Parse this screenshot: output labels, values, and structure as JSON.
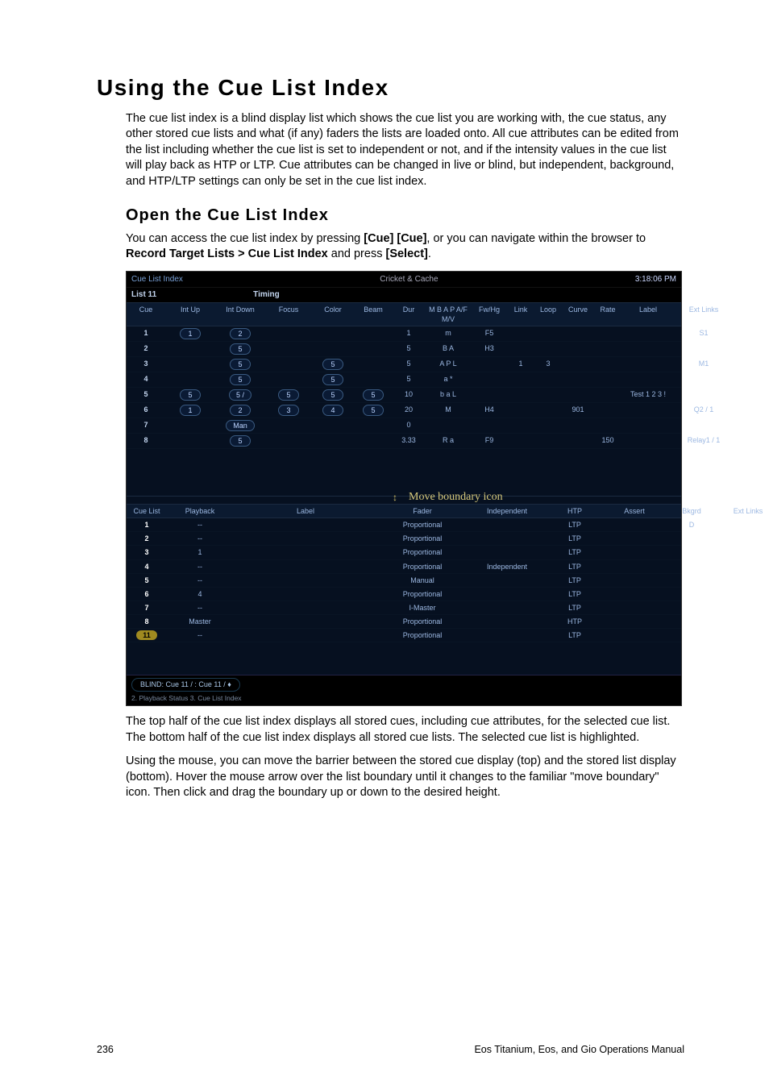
{
  "page": {
    "number": "236",
    "manual_title": "Eos Titanium, Eos, and Gio Operations Manual"
  },
  "heading": "Using the Cue List Index",
  "intro": "The cue list index is a blind display list which shows the cue list you are working with, the cue status, any other stored cue lists and what (if any) faders the lists are loaded onto. All cue attributes can be edited from the list including whether the cue list is set to independent or not, and if the intensity values in the cue list will play back as HTP or LTP. Cue attributes can be changed in live or blind, but independent, background, and HTP/LTP settings can only be set in the cue list index.",
  "subhead": "Open the Cue List Index",
  "open_para_pre": "You can access the cue list index by pressing ",
  "open_bold1": "[Cue] [Cue]",
  "open_mid": ", or you can navigate within the browser to ",
  "open_bold2": "Record Target Lists > Cue List Index",
  "open_mid2": " and press ",
  "open_bold3": "[Select]",
  "open_end": ".",
  "screenshot": {
    "title_left": "Cue List Index",
    "title_center": "Cricket & Cache",
    "title_right": "3:18:06 PM",
    "list_label": "List 11",
    "timing_label": "Timing",
    "top_headers": [
      "Cue",
      "Int Up",
      "Int Down",
      "Focus",
      "Color",
      "Beam",
      "Dur",
      "M B A P  A/F  M/V",
      "Fw/Hg",
      "Link",
      "Loop",
      "Curve",
      "Rate",
      "Label",
      "Ext Links"
    ],
    "top_rows": [
      {
        "cue": "1",
        "up": "1",
        "down": "2",
        "focus": "",
        "color": "",
        "beam": "",
        "dur": "1",
        "mbap": "m",
        "fw": "F5",
        "link": "",
        "loop": "",
        "curve": "",
        "rate": "",
        "label": "",
        "ext": "S1"
      },
      {
        "cue": "2",
        "up": "",
        "down": "5",
        "focus": "",
        "color": "",
        "beam": "",
        "dur": "5",
        "mbap": "B A",
        "fw": "H3",
        "link": "",
        "loop": "",
        "curve": "",
        "rate": "",
        "label": "",
        "ext": ""
      },
      {
        "cue": "3",
        "up": "",
        "down": "5",
        "focus": "",
        "color": "5",
        "beam": "",
        "dur": "5",
        "mbap": "A P   L",
        "fw": "",
        "link": "1",
        "loop": "3",
        "curve": "",
        "rate": "",
        "label": "",
        "ext": "M1"
      },
      {
        "cue": "4",
        "up": "",
        "down": "5",
        "focus": "",
        "color": "5",
        "beam": "",
        "dur": "5",
        "mbap": "a    *",
        "fw": "",
        "link": "",
        "loop": "",
        "curve": "",
        "rate": "",
        "label": "",
        "ext": ""
      },
      {
        "cue": "5",
        "up": "5",
        "down": "5 /",
        "focus": "5",
        "color": "5",
        "beam": "5",
        "dur": "10",
        "mbap": "b a   L",
        "fw": "",
        "link": "",
        "loop": "",
        "curve": "",
        "rate": "",
        "label": "Test 1 2 3 !",
        "ext": ""
      },
      {
        "cue": "6",
        "up": "1",
        "down": "2",
        "focus": "3",
        "color": "4",
        "beam": "5",
        "dur": "20",
        "mbap": "M",
        "fw": "H4",
        "link": "",
        "loop": "",
        "curve": "901",
        "rate": "",
        "label": "",
        "ext": "Q2 / 1"
      },
      {
        "cue": "7",
        "up": "",
        "down": "Man",
        "focus": "",
        "color": "",
        "beam": "",
        "dur": "0",
        "mbap": "",
        "fw": "",
        "link": "",
        "loop": "",
        "curve": "",
        "rate": "",
        "label": "",
        "ext": ""
      },
      {
        "cue": "8",
        "up": "",
        "down": "5",
        "focus": "",
        "color": "",
        "beam": "",
        "dur": "3.33",
        "mbap": "R   a",
        "fw": "F9",
        "link": "",
        "loop": "",
        "curve": "",
        "rate": "150",
        "label": "",
        "ext": "Relay1 / 1"
      }
    ],
    "boundary_label": "Move boundary icon",
    "cl_headers": [
      "Cue List",
      "Playback",
      "Label",
      "Fader",
      "Independent",
      "HTP",
      "Assert",
      "Bkgrd",
      "Ext Links"
    ],
    "cl_rows": [
      {
        "n": "1",
        "pb": "--",
        "lbl": "",
        "fader": "Proportional",
        "ind": "",
        "htp": "LTP",
        "as": "",
        "bk": "D",
        "ext": ""
      },
      {
        "n": "2",
        "pb": "--",
        "lbl": "",
        "fader": "Proportional",
        "ind": "",
        "htp": "LTP",
        "as": "",
        "bk": "",
        "ext": ""
      },
      {
        "n": "3",
        "pb": "1",
        "lbl": "",
        "fader": "Proportional",
        "ind": "",
        "htp": "LTP",
        "as": "",
        "bk": "",
        "ext": ""
      },
      {
        "n": "4",
        "pb": "--",
        "lbl": "",
        "fader": "Proportional",
        "ind": "Independent",
        "htp": "LTP",
        "as": "",
        "bk": "",
        "ext": ""
      },
      {
        "n": "5",
        "pb": "--",
        "lbl": "",
        "fader": "Manual",
        "ind": "",
        "htp": "LTP",
        "as": "",
        "bk": "",
        "ext": ""
      },
      {
        "n": "6",
        "pb": "4",
        "lbl": "",
        "fader": "Proportional",
        "ind": "",
        "htp": "LTP",
        "as": "",
        "bk": "",
        "ext": ""
      },
      {
        "n": "7",
        "pb": "--",
        "lbl": "",
        "fader": "I-Master",
        "ind": "",
        "htp": "LTP",
        "as": "",
        "bk": "",
        "ext": ""
      },
      {
        "n": "8",
        "pb": "Master",
        "lbl": "",
        "fader": "Proportional",
        "ind": "",
        "htp": "HTP",
        "as": "",
        "bk": "",
        "ext": ""
      },
      {
        "n": "11",
        "pb": "--",
        "lbl": "",
        "fader": "Proportional",
        "ind": "",
        "htp": "LTP",
        "as": "",
        "bk": "",
        "ext": "",
        "sel": true
      }
    ],
    "cmd_line": "BLIND: Cue  11 / :   Cue 11 / ♦",
    "tabs": "2. Playback Status     3. Cue List Index"
  },
  "para2": "The top half of the cue list index displays all stored cues, including cue attributes, for the selected cue list. The bottom half of the cue list index displays all stored cue lists. The selected cue list is highlighted.",
  "para3": "Using the mouse, you can move the barrier between the stored cue display (top) and the stored list display (bottom). Hover the mouse arrow over the list boundary until it changes to the familiar \"move boundary\" icon. Then click and drag the boundary up or down to the desired height."
}
